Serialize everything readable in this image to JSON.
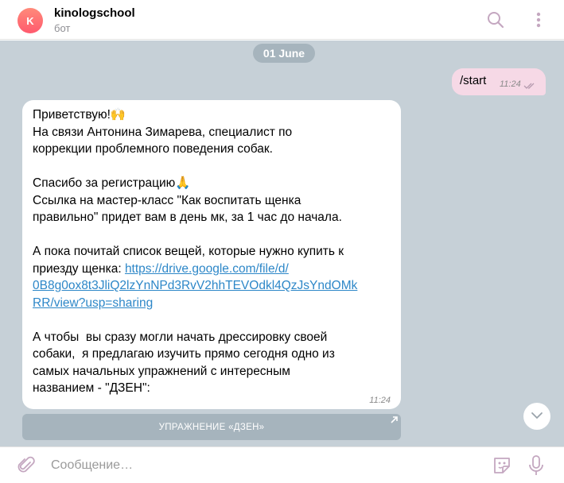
{
  "header": {
    "avatar_letter": "K",
    "title": "kinologschool",
    "subtitle": "бот",
    "search_icon": "search-icon",
    "menu_icon": "more-vertical-icon"
  },
  "chat": {
    "date_label": "01 June",
    "outgoing": {
      "text": "/start",
      "time": "11:24",
      "status_icon": "double-check-icon"
    },
    "incoming": {
      "text_1": "Приветствую!🙌\nНа связи Антонина Зимарева, специалист по\nкоррекции проблемного поведения собак.\n\nСпасибо за регистрацию🙏\nСсылка на мастер-класс \"Как воспитать щенка\nправильно\" придет вам в день мк, за 1 час до начала.\n\nА пока почитай список вещей, которые нужно купить к\nприезду щенка: ",
      "link": "https://drive.google.com/file/d/\n0B8g0ox8t3JliQ2lzYnNPd3RvV2hhTEVOdkl4QzJsYndOMk\nRR/view?usp=sharing",
      "text_2": "\n\nА чтобы  вы сразу могли начать дрессировку своей\nсобаки,  я предлагаю изучить прямо сегодня одно из\nсамых начальных упражнений с интересным\nназванием - \"ДЗЕН\":",
      "time": "11:24"
    },
    "inline_button": {
      "label": "УПРАЖНЕНИЕ  «ДЗЕН»",
      "icon": "external-arrow-icon"
    },
    "scroll_down_icon": "chevron-down-icon"
  },
  "composer": {
    "placeholder": "Сообщение…",
    "value": "",
    "attach_icon": "paperclip-icon",
    "sticker_icon": "sticker-icon",
    "mic_icon": "microphone-icon"
  },
  "colors": {
    "avatar": "#ff5a6e",
    "chat_bg": "#c6d0d7",
    "outgoing_bubble": "#f6d9e6",
    "incoming_bubble": "#ffffff",
    "link": "#2d87c8",
    "pill": "#a6b4bd",
    "icons": "#c4a7c0"
  }
}
